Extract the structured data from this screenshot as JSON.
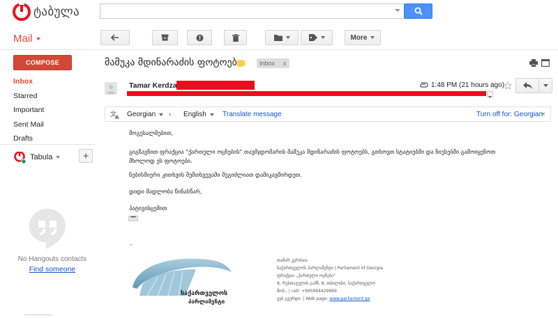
{
  "header": {
    "logo_text": "ტაბულა",
    "search_placeholder": "",
    "colors": {
      "logo_red": "#e8101f",
      "search_blue": "#4d90fe"
    }
  },
  "mail_label": "Mail",
  "toolbar": {
    "more_label": "More"
  },
  "sidebar": {
    "compose_label": "COMPOSE",
    "items": [
      {
        "label": "Inbox",
        "active": true
      },
      {
        "label": "Starred",
        "active": false
      },
      {
        "label": "Important",
        "active": false
      },
      {
        "label": "Sent Mail",
        "active": false
      },
      {
        "label": "Drafts",
        "active": false
      }
    ],
    "account_name": "Tabula",
    "no_hangouts": "No Hangouts contacts",
    "find_someone": "Find someone"
  },
  "message": {
    "subject": "მამუკა მდინარაძის ფოტოები",
    "inbox_chip": "Inbox",
    "chip_close": "x",
    "sender_name": "Tamar Kerdzaia",
    "time": "1:48 PM (21 hours ago)",
    "translate": {
      "from_lang": "Georgian",
      "to_lang": "English",
      "translate_link": "Translate message",
      "turn_off": "Turn off for: Georgian"
    },
    "body": [
      "მოგესალმებით,",
      "გიგზავნით ფრაქცია \"ქართული ოცნების\" თავმჯდომარის მამუკა მდინარაძის ფოტოებს, გთხოვთ სტატიებში და ნიუსებში გამოიყენოთ",
      "მხოლოდ ეს ფოტოები.",
      "ნებისმიერი კითხვის შემთხვევაში შეგიძლიათ დამიკავშირდეთ.",
      "დიდი მადლობა წინასწარ,",
      "პატივისცემით"
    ],
    "ellipsis": "•••",
    "signature_dash": "--",
    "signature": {
      "line1": "თამარ კერძაია",
      "line2": "საქართველოს პარლამენტი | Parliament of Georgia",
      "line3": "ფრაქცია „ქართული ოცნება\"",
      "line4": "8, რუსთაველის გამზ. 8, თბილისი, საქართველო",
      "line5": "მობ.: | cell: +995994429999",
      "line6_prefix": "ვებ გვერდი: | Web page: ",
      "line6_link": "www.parliament.ge",
      "logo_line1": "საქართველოს",
      "logo_line2": "პარლამენტი"
    }
  }
}
